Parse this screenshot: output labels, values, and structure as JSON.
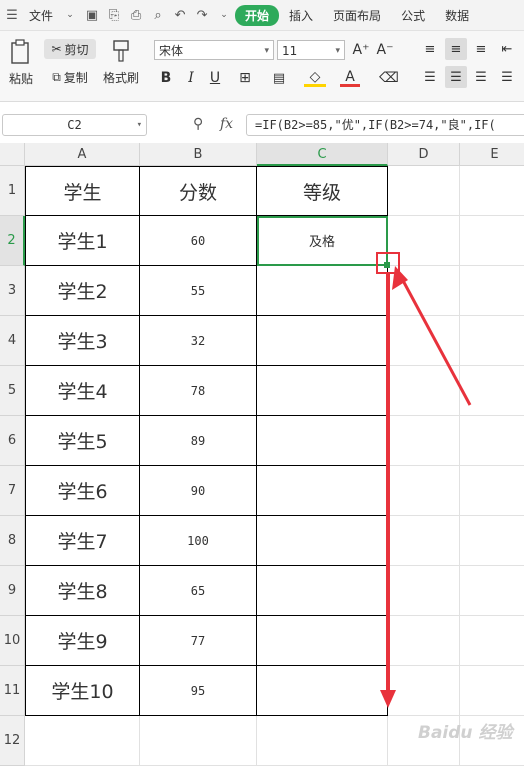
{
  "menubar": {
    "file_label": "文件",
    "tabs": [
      "开始",
      "插入",
      "页面布局",
      "公式",
      "数据"
    ],
    "active_tab": "开始"
  },
  "ribbon": {
    "paste": "粘贴",
    "cut": "剪切",
    "copy": "复制",
    "format_painter": "格式刷",
    "font_name": "宋体",
    "font_size": "11"
  },
  "formula_bar": {
    "name_box": "C2",
    "fx_label": "fx",
    "formula": "=IF(B2>=85,\"优\",IF(B2>=74,\"良\",IF("
  },
  "sheet": {
    "columns": [
      "A",
      "B",
      "C",
      "D",
      "E"
    ],
    "rows": [
      "1",
      "2",
      "3",
      "4",
      "5",
      "6",
      "7",
      "8",
      "9",
      "10",
      "11",
      "12"
    ],
    "header": [
      "学生",
      "分数",
      "等级"
    ],
    "data": [
      [
        "学生1",
        "60",
        "及格"
      ],
      [
        "学生2",
        "55",
        ""
      ],
      [
        "学生3",
        "32",
        ""
      ],
      [
        "学生4",
        "78",
        ""
      ],
      [
        "学生5",
        "89",
        ""
      ],
      [
        "学生6",
        "90",
        ""
      ],
      [
        "学生7",
        "100",
        ""
      ],
      [
        "学生8",
        "65",
        ""
      ],
      [
        "学生9",
        "77",
        ""
      ],
      [
        "学生10",
        "95",
        ""
      ]
    ]
  },
  "colors": {
    "accent": "#2eaa5b",
    "arrow": "#e8323c"
  },
  "watermark": "Baidu 经验"
}
